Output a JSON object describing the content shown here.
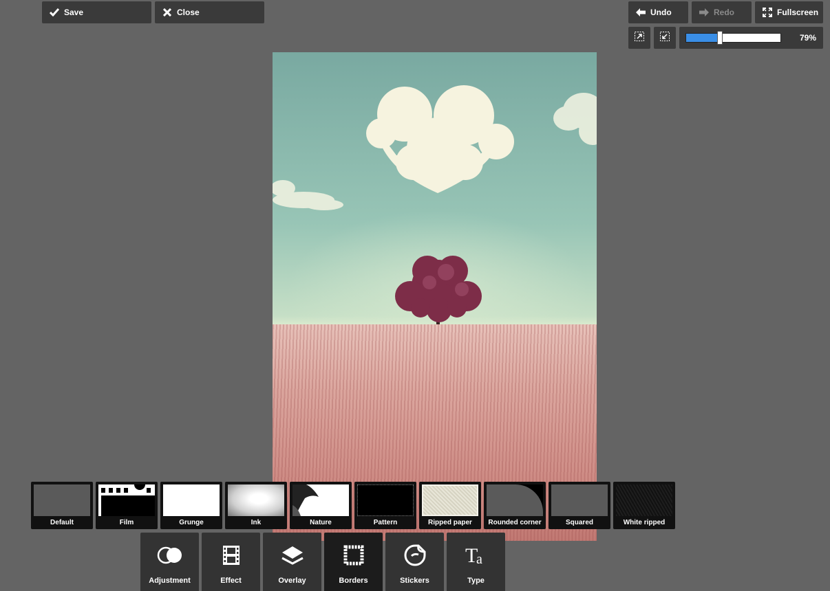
{
  "toolbar": {
    "save": "Save",
    "close": "Close",
    "undo": "Undo",
    "redo": "Redo",
    "fullscreen": "Fullscreen"
  },
  "zoom": {
    "percent_label": "79%",
    "level": 0.35
  },
  "icons": {
    "save": "check-icon",
    "close": "x-icon",
    "undo": "arrow-left-icon",
    "redo": "arrow-right-icon",
    "fullscreen": "expand-icon",
    "fit": "fit-to-screen-icon",
    "actual": "actual-size-icon"
  },
  "borders": [
    {
      "label": "Default"
    },
    {
      "label": "Film"
    },
    {
      "label": "Grunge"
    },
    {
      "label": "Ink"
    },
    {
      "label": "Nature"
    },
    {
      "label": "Pattern"
    },
    {
      "label": "Ripped paper"
    },
    {
      "label": "Rounded corner"
    },
    {
      "label": "Squared"
    },
    {
      "label": "White ripped"
    }
  ],
  "tools": [
    {
      "label": "Adjustment",
      "icon": "circles-icon"
    },
    {
      "label": "Effect",
      "icon": "film-strip-icon"
    },
    {
      "label": "Overlay",
      "icon": "layers-icon"
    },
    {
      "label": "Borders",
      "icon": "frame-icon",
      "active": true
    },
    {
      "label": "Stickers",
      "icon": "sticker-icon"
    },
    {
      "label": "Type",
      "icon": "type-icon"
    }
  ],
  "colors": {
    "background": "#646464",
    "button": "#3a3a3a",
    "accent": "#3a8ee6"
  }
}
